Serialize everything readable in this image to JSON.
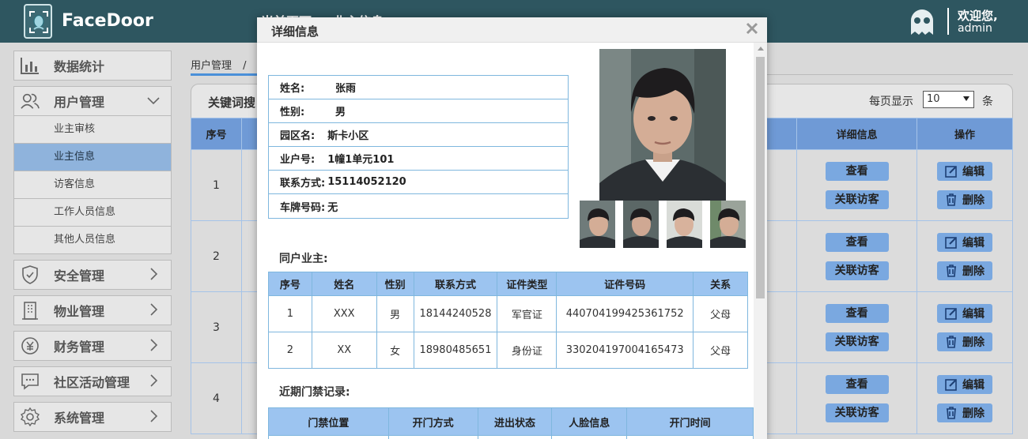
{
  "app": {
    "brand": "FaceDoor",
    "hidden_title": "当前页面 — 业主信息"
  },
  "user": {
    "welcome": "欢迎您,",
    "name": "admin"
  },
  "sidebar": {
    "items": [
      {
        "label": "数据统计",
        "icon": "bar-chart-icon"
      },
      {
        "label": "用户管理",
        "icon": "users-icon",
        "expanded": true
      },
      {
        "label": "安全管理",
        "icon": "shield-icon"
      },
      {
        "label": "物业管理",
        "icon": "building-icon"
      },
      {
        "label": "财务管理",
        "icon": "money-icon"
      },
      {
        "label": "社区活动管理",
        "icon": "chat-icon"
      },
      {
        "label": "系统管理",
        "icon": "gear-icon"
      }
    ],
    "subitems": [
      "业主审核",
      "业主信息",
      "访客信息",
      "工作人员信息",
      "其他人员信息"
    ],
    "active_subitem": "业主信息"
  },
  "breadcrumb": {
    "root": "用户管理",
    "sep": "/"
  },
  "filter": {
    "keyword_label": "关键词搜",
    "per_page_label": "每页显示",
    "per_page_value": "10",
    "per_page_unit": "条"
  },
  "table": {
    "headers": {
      "index": "序号",
      "detail": "详细信息",
      "ops": "操作"
    },
    "rows": [
      "1",
      "2",
      "3",
      "4"
    ],
    "view_label": "查看",
    "linked_label": "关联访客",
    "edit_label": "编辑",
    "delete_label": "删除"
  },
  "modal": {
    "title": "详细信息",
    "fields": [
      {
        "key": "姓名:",
        "value": "张雨"
      },
      {
        "key": "性别:",
        "value": "男"
      },
      {
        "key": "园区名:",
        "value": "斯卡小区"
      },
      {
        "key": "业户号:",
        "value": "1幢1单元101"
      },
      {
        "key": "联系方式:",
        "value": "15114052120"
      },
      {
        "key": "车牌号码:",
        "value": "无"
      }
    ],
    "co_owner_title": "同户业主:",
    "co_owner_headers": [
      "序号",
      "姓名",
      "性别",
      "联系方式",
      "证件类型",
      "证件号码",
      "关系"
    ],
    "co_owners": [
      [
        "1",
        "XXX",
        "男",
        "18144240528",
        "军官证",
        "440704199425361752",
        "父母"
      ],
      [
        "2",
        "XX",
        "女",
        "18980485651",
        "身份证",
        "330204197004165473",
        "父母"
      ]
    ],
    "records_title": "近期门禁记录:",
    "records_headers": [
      "门禁位置",
      "开门方式",
      "进出状态",
      "人脸信息",
      "开门时间"
    ]
  },
  "colors": {
    "topbar": "#2e5660",
    "header_blue": "#6f9ad6",
    "button_blue": "#7aa8e0",
    "active_nav": "#8fb3dc"
  }
}
